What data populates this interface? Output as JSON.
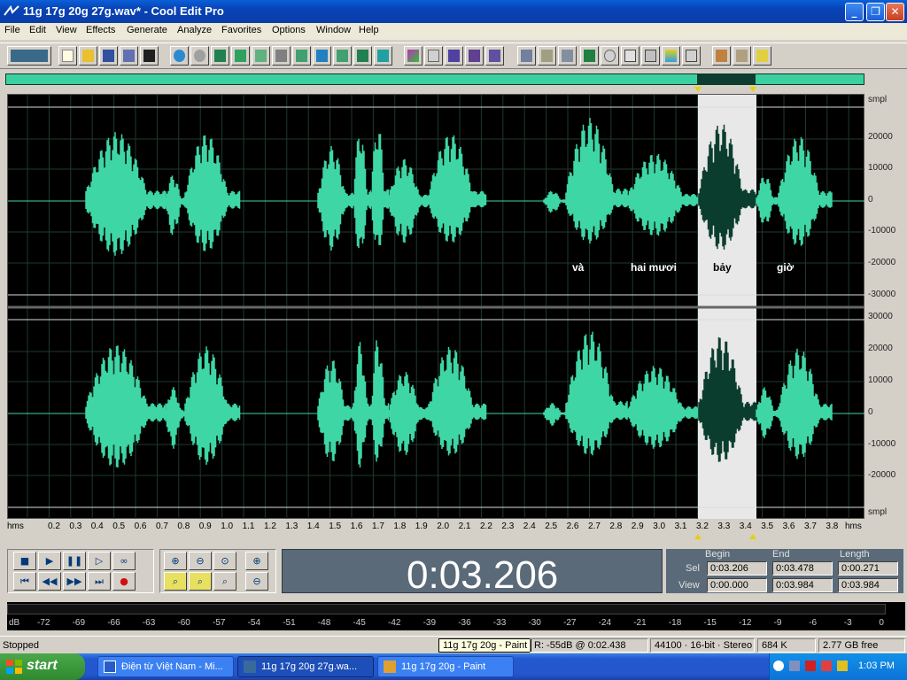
{
  "window": {
    "title": "11g 17g 20g 27g.wav* - Cool Edit Pro"
  },
  "menu": [
    "File",
    "Edit",
    "View",
    "Effects",
    "Generate",
    "Analyze",
    "Favorites",
    "Options",
    "Window",
    "Help"
  ],
  "toolbar": {
    "icons": [
      "waveform-multitrack-toggle-icon",
      "new-icon",
      "open-icon",
      "save-icon",
      "save-as-icon",
      "save-all-icon",
      "undo-icon",
      "redo-icon",
      "loop-icon",
      "cut-marker-icon",
      "copy-icon",
      "paste-icon",
      "scissors-icon",
      "paste-into-icon",
      "mix-paste-icon",
      "insert-icon",
      "multitrack-insert-icon",
      "find-icon",
      "spectral-icon",
      "options-icon",
      "record-icon",
      "play-icon",
      "stop-icon",
      "view-icon",
      "display-icon",
      "time-icon",
      "zoom-icon",
      "cue-icon",
      "list-icon",
      "metronome-icon",
      "settings-icon",
      "tips-icon",
      "help-icon"
    ]
  },
  "waveform": {
    "y_unit": "smpl",
    "y_ticks": [
      "30000",
      "20000",
      "10000",
      "0",
      "-10000",
      "-20000",
      "-30000"
    ],
    "word_labels": [
      "và",
      "hai mươi",
      "bảy",
      "giờ"
    ]
  },
  "time_ruler": {
    "unit": "hms",
    "ticks": [
      "0.2",
      "0.3",
      "0.4",
      "0.5",
      "0.6",
      "0.7",
      "0.8",
      "0.9",
      "1.0",
      "1.1",
      "1.2",
      "1.3",
      "1.4",
      "1.5",
      "1.6",
      "1.7",
      "1.8",
      "1.9",
      "2.0",
      "2.1",
      "2.2",
      "2.3",
      "2.4",
      "2.5",
      "2.6",
      "2.7",
      "2.8",
      "2.9",
      "3.0",
      "3.1",
      "3.2",
      "3.3",
      "3.4",
      "3.5",
      "3.6",
      "3.7",
      "3.8"
    ]
  },
  "transport": {
    "time": "0:03.206"
  },
  "selection": {
    "headers": [
      "Begin",
      "End",
      "Length"
    ],
    "sel_label": "Sel",
    "view_label": "View",
    "sel": [
      "0:03.206",
      "0:03.478",
      "0:00.271"
    ],
    "view": [
      "0:00.000",
      "0:03.984",
      "0:03.984"
    ]
  },
  "level_meter": {
    "unit": "dB",
    "ticks": [
      "-72",
      "-69",
      "-66",
      "-63",
      "-60",
      "-57",
      "-54",
      "-51",
      "-48",
      "-45",
      "-42",
      "-39",
      "-36",
      "-33",
      "-30",
      "-27",
      "-24",
      "-21",
      "-18",
      "-15",
      "-12",
      "-9",
      "-6",
      "-3",
      "0"
    ]
  },
  "status": {
    "state": "Stopped",
    "tooltip": "11g 17g 20g - Paint",
    "cursor": "R: -55dB @  0:02.438",
    "format": "44100 · 16-bit · Stereo",
    "size": "684 K",
    "free": "2.77 GB free"
  },
  "taskbar": {
    "start": "start",
    "tasks": [
      "Điện từ Việt Nam - Mi...",
      "11g 17g 20g 27g.wa...",
      "11g 17g 20g - Paint"
    ],
    "clock": "1:03 PM"
  },
  "colors": {
    "wave": "#3fd6a6",
    "wave_selected": "#0b3d2e",
    "selection_bg": "#e8e8e8",
    "background": "#000000"
  }
}
